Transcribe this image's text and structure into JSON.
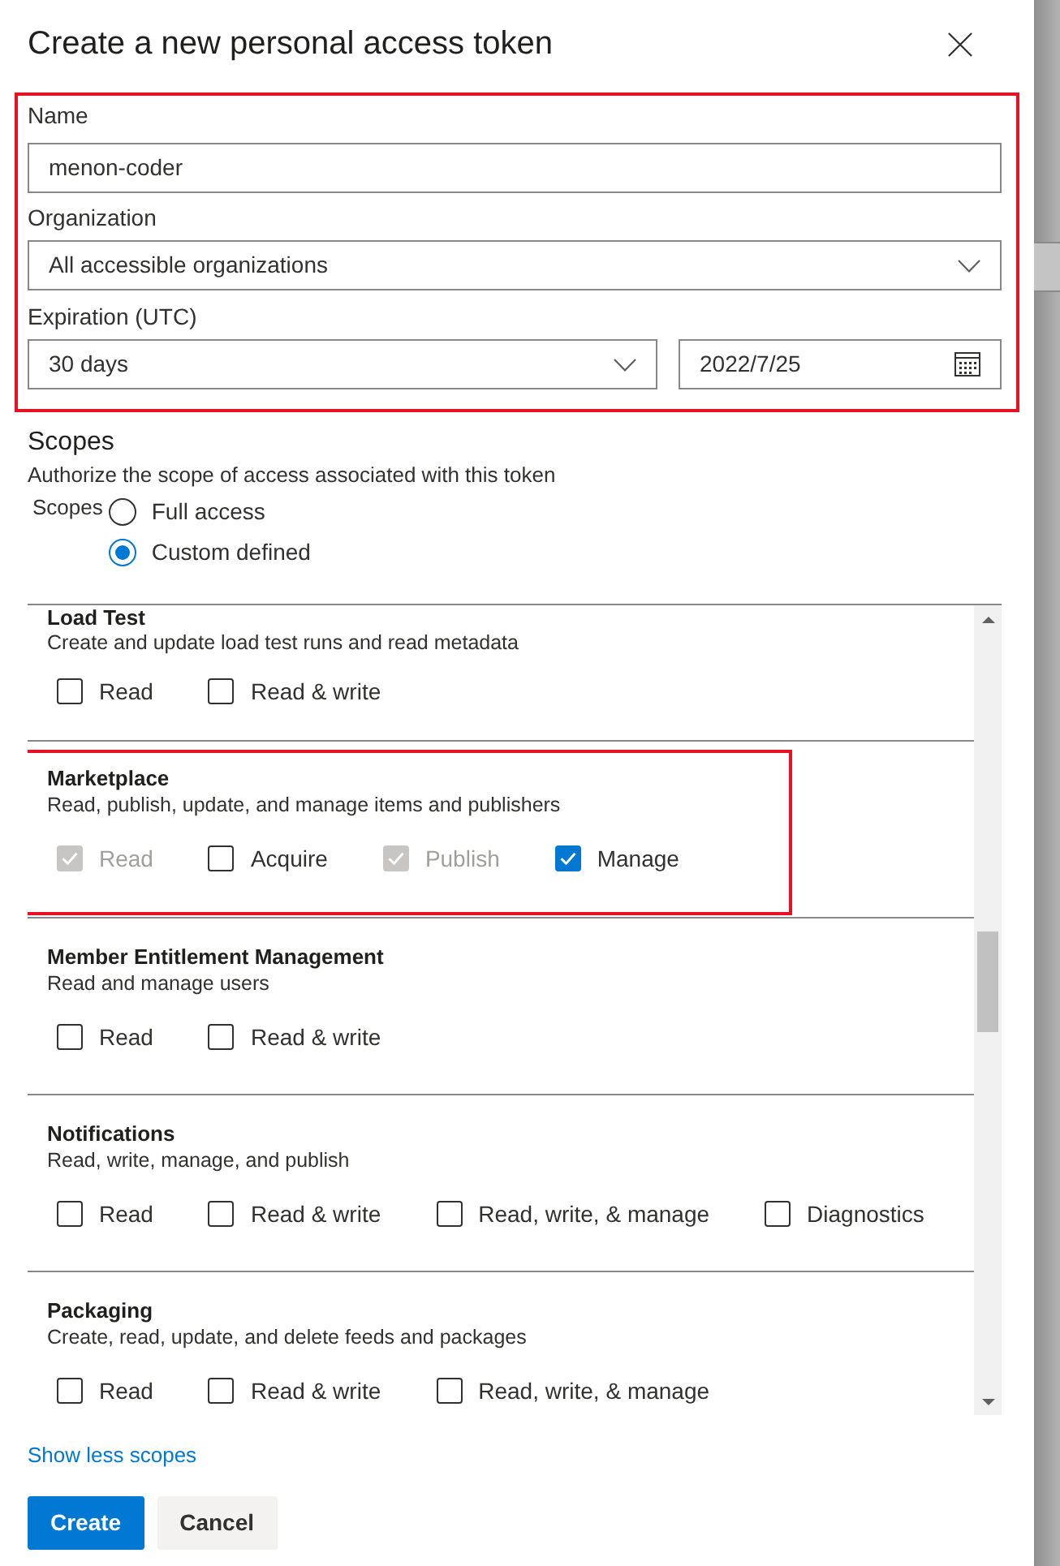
{
  "dialog": {
    "title": "Create a new personal access token"
  },
  "form": {
    "highlighted": true,
    "name": {
      "label": "Name",
      "value": "menon-coder"
    },
    "organization": {
      "label": "Organization",
      "value": "All accessible organizations"
    },
    "expiration": {
      "label": "Expiration (UTC)",
      "value": "30 days",
      "date": "2022/7/25"
    }
  },
  "scopes": {
    "title": "Scopes",
    "description": "Authorize the scope of access associated with this token",
    "group_label": "Scopes",
    "options": [
      {
        "label": "Full access",
        "selected": false
      },
      {
        "label": "Custom defined",
        "selected": true
      }
    ]
  },
  "scope_list": [
    {
      "name": "Load Test",
      "description": "Create and update load test runs and read metadata",
      "highlighted": false,
      "permissions": [
        {
          "label": "Read",
          "checked": false,
          "disabled": false
        },
        {
          "label": "Read & write",
          "checked": false,
          "disabled": false
        }
      ]
    },
    {
      "name": "Marketplace",
      "description": "Read, publish, update, and manage items and publishers",
      "highlighted": true,
      "permissions": [
        {
          "label": "Read",
          "checked": true,
          "disabled": true
        },
        {
          "label": "Acquire",
          "checked": false,
          "disabled": false
        },
        {
          "label": "Publish",
          "checked": true,
          "disabled": true
        },
        {
          "label": "Manage",
          "checked": true,
          "disabled": false
        }
      ]
    },
    {
      "name": "Member Entitlement Management",
      "description": "Read and manage users",
      "highlighted": false,
      "permissions": [
        {
          "label": "Read",
          "checked": false,
          "disabled": false
        },
        {
          "label": "Read & write",
          "checked": false,
          "disabled": false
        }
      ]
    },
    {
      "name": "Notifications",
      "description": "Read, write, manage, and publish",
      "highlighted": false,
      "permissions": [
        {
          "label": "Read",
          "checked": false,
          "disabled": false
        },
        {
          "label": "Read & write",
          "checked": false,
          "disabled": false
        },
        {
          "label": "Read, write, & manage",
          "checked": false,
          "disabled": false
        },
        {
          "label": "Diagnostics",
          "checked": false,
          "disabled": false
        }
      ]
    },
    {
      "name": "Packaging",
      "description": "Create, read, update, and delete feeds and packages",
      "highlighted": false,
      "permissions": [
        {
          "label": "Read",
          "checked": false,
          "disabled": false
        },
        {
          "label": "Read & write",
          "checked": false,
          "disabled": false
        },
        {
          "label": "Read, write, & manage",
          "checked": false,
          "disabled": false
        }
      ]
    }
  ],
  "show_less_link": "Show less scopes",
  "buttons": [
    {
      "label": "Create",
      "kind": "primary"
    },
    {
      "label": "Cancel",
      "kind": "secondary"
    }
  ]
}
